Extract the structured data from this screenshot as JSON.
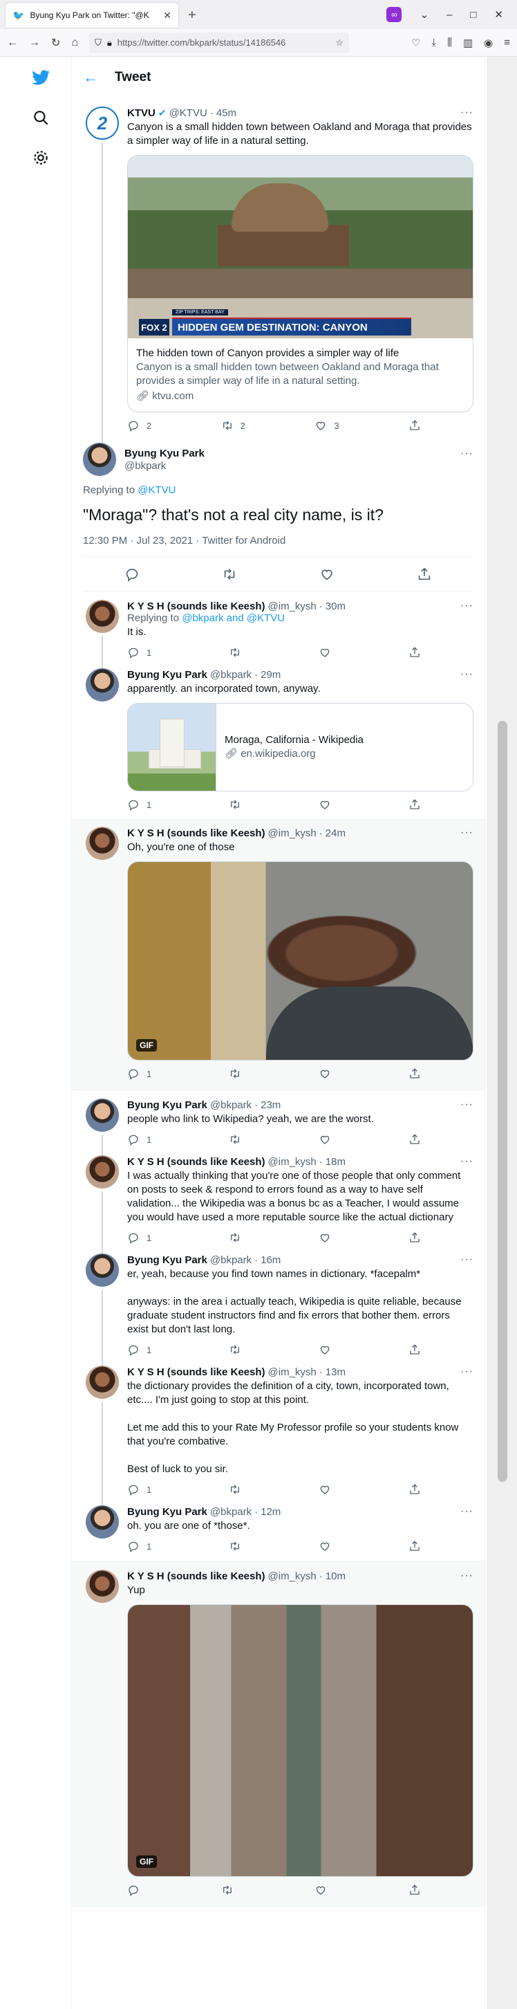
{
  "browser": {
    "tab_title": "Byung Kyu Park on Twitter: \"@K",
    "url": "https://twitter.com/bkpark/status/14186546"
  },
  "page": {
    "header_title": "Tweet"
  },
  "tweets": [
    {
      "name": "KTVU",
      "handle": "@KTVU",
      "dot": "·",
      "time": "45m",
      "text": "Canyon is a small hidden town between Oakland and Moraga that provides a simpler way of life in a natural setting.",
      "card": {
        "overlay_kicker": "ZIP TRIPS: EAST BAY",
        "overlay_title": "HIDDEN GEM DESTINATION: CANYON",
        "overlay_logo": "FOX 2",
        "title": "The hidden town of Canyon provides a simpler way of life",
        "description": "Canyon is a small hidden town between Oakland and Moraga that provides a simpler way of life in a natural setting.",
        "domain": "ktvu.com"
      },
      "replies": "2",
      "retweets": "2",
      "likes": "3"
    },
    {
      "name": "Byung Kyu Park",
      "handle": "@bkpark",
      "replying_prefix": "Replying to ",
      "replying_to": "@KTVU",
      "text": "\"Moraga\"? that's not a real city name, is it?",
      "timestamp": "12:30 PM · Jul 23, 2021",
      "dot": " · ",
      "source": "Twitter for Android"
    },
    {
      "name": "K Y S H (sounds like Keesh)",
      "handle": "@im_kysh",
      "dot": "·",
      "time": "30m",
      "replying_prefix": "Replying to ",
      "replying_to": "@bkpark and @KTVU",
      "text": "It is.",
      "replies": "1"
    },
    {
      "name": "Byung Kyu Park",
      "handle": "@bkpark",
      "dot": "·",
      "time": "29m",
      "text": "apparently. an incorporated town, anyway.",
      "card": {
        "title": "Moraga, California - Wikipedia",
        "domain": "en.wikipedia.org"
      },
      "replies": "1"
    },
    {
      "name": "K Y S H (sounds like Keesh)",
      "handle": "@im_kysh",
      "dot": "·",
      "time": "24m",
      "text": "Oh, you're one of those",
      "gif_label": "GIF",
      "replies": "1"
    },
    {
      "name": "Byung Kyu Park",
      "handle": "@bkpark",
      "dot": "·",
      "time": "23m",
      "text": "people who link to Wikipedia? yeah, we are the worst.",
      "replies": "1"
    },
    {
      "name": "K Y S H (sounds like Keesh)",
      "handle": "@im_kysh",
      "dot": "·",
      "time": "18m",
      "text": "I was actually thinking that you're one of those people that only comment on posts to seek & respond to errors found as a way to have self validation... the Wikipedia was a bonus bc as a Teacher, I would assume you would have used a more reputable source like the actual dictionary",
      "replies": "1"
    },
    {
      "name": "Byung Kyu Park",
      "handle": "@bkpark",
      "dot": "·",
      "time": "16m",
      "text": "er, yeah, because you find town names in dictionary. *facepalm*\n\nanyways: in the area i actually teach, Wikipedia is quite reliable, because graduate student instructors find and fix errors that bother them. errors exist but don't last long.",
      "replies": "1"
    },
    {
      "name": "K Y S H (sounds like Keesh)",
      "handle": "@im_kysh",
      "dot": "·",
      "time": "13m",
      "text": "the dictionary provides the definition of a city, town, incorporated town, etc.... I'm just going to stop at this point.\n\nLet me add this to your Rate My Professor profile so your students know that you're combative.\n\nBest of luck to you sir.",
      "replies": "1"
    },
    {
      "name": "Byung Kyu Park",
      "handle": "@bkpark",
      "dot": "·",
      "time": "12m",
      "text": "oh. you are one of *those*.",
      "replies": "1"
    },
    {
      "name": "K Y S H (sounds like Keesh)",
      "handle": "@im_kysh",
      "dot": "·",
      "time": "10m",
      "text": "Yup",
      "gif_label": "GIF"
    }
  ],
  "icons": {
    "twitter": "twitter-bird-icon",
    "search": "search-icon",
    "settings": "gear-icon",
    "reply": "reply-icon",
    "retweet": "retweet-icon",
    "like": "heart-icon",
    "share": "share-icon"
  },
  "colors": {
    "accent": "#1d9bf0",
    "secondary_text": "#536471"
  }
}
